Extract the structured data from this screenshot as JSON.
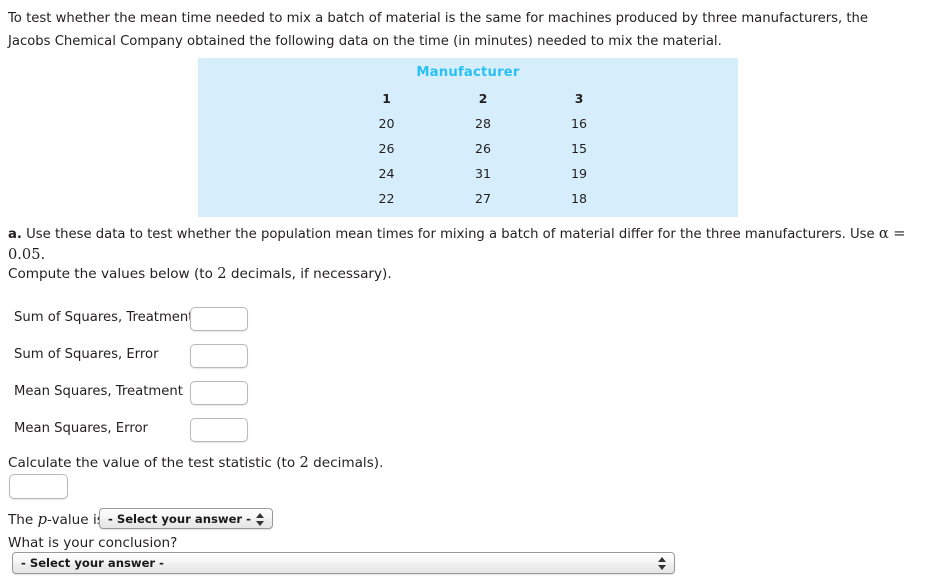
{
  "intro": {
    "text": "To test whether the mean time needed to mix a batch of material is the same for machines produced by three manufacturers, the Jacobs Chemical Company obtained the following data on the time (in minutes) needed to mix the material."
  },
  "table": {
    "title": "Manufacturer",
    "title_color": "#29c0f5",
    "background_color": "#d6eefb",
    "headers": [
      "1",
      "2",
      "3"
    ],
    "rows": [
      [
        "20",
        "28",
        "16"
      ],
      [
        "26",
        "26",
        "15"
      ],
      [
        "24",
        "31",
        "19"
      ],
      [
        "22",
        "27",
        "18"
      ]
    ]
  },
  "part_a": {
    "marker": "a.",
    "text_before": " Use these data to test whether the population mean times for mixing a batch of material differ for the three manufacturers. Use ",
    "alpha_expr": "α = 0.05",
    "text_after": "."
  },
  "compute_line": {
    "before": "Compute the values below (to ",
    "decimals": "2",
    "after": " decimals, if necessary)."
  },
  "fields": [
    {
      "label": "Sum of Squares, Treatment",
      "value": ""
    },
    {
      "label": "Sum of Squares, Error",
      "value": ""
    },
    {
      "label": "Mean Squares, Treatment",
      "value": ""
    },
    {
      "label": "Mean Squares, Error",
      "value": ""
    }
  ],
  "test_statistic": {
    "prompt_before": "Calculate the value of the test statistic (to ",
    "decimals": "2",
    "prompt_after": " decimals).",
    "value": ""
  },
  "pvalue": {
    "label_before": "The ",
    "symbol": "p",
    "label_after": "-value is",
    "selected": "- Select your answer -"
  },
  "conclusion": {
    "question": "What is your conclusion?",
    "selected": "- Select your answer -"
  }
}
